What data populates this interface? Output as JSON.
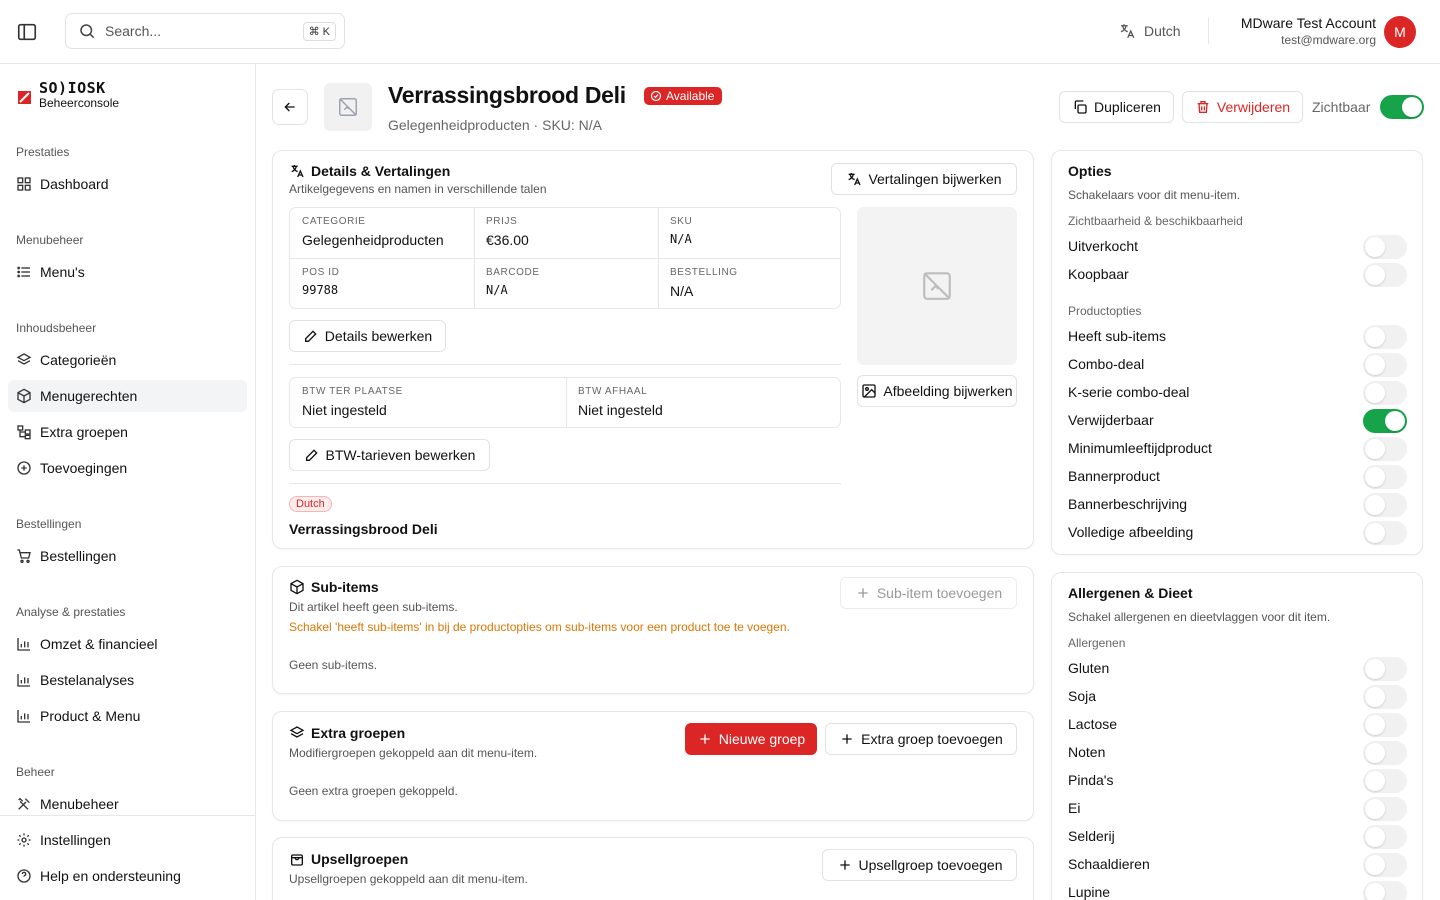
{
  "topbar": {
    "search_placeholder": "Search...",
    "search_shortcut": "⌘ K",
    "language": "Dutch",
    "account_name": "MDware Test Account",
    "account_email": "test@mdware.org",
    "avatar_initial": "M"
  },
  "brand": {
    "logo": "SO)IOSK",
    "subtitle": "Beheerconsole"
  },
  "sidebar": {
    "sections": [
      "Prestaties",
      "Menubeheer",
      "Inhoudsbeheer",
      "Bestellingen",
      "Analyse & prestaties",
      "Beheer"
    ],
    "items": {
      "dashboard": "Dashboard",
      "menus": "Menu's",
      "categories": "Categorieën",
      "dishes": "Menugerechten",
      "extra_groups": "Extra groepen",
      "additions": "Toevoegingen",
      "orders": "Bestellingen",
      "revenue": "Omzet & financieel",
      "order_analytics": "Bestelanalyses",
      "product_menu": "Product & Menu",
      "menu_management": "Menubeheer",
      "settings": "Instellingen",
      "help": "Help en ondersteuning"
    },
    "active": "Menugerechten"
  },
  "header": {
    "title": "Verrassingsbrood Deli",
    "status": "Available",
    "subtitle": "Gelegenheidproducten · SKU: N/A",
    "duplicate": "Dupliceren",
    "delete": "Verwijderen",
    "visible_label": "Zichtbaar",
    "visible": true
  },
  "details": {
    "title": "Details & Vertalingen",
    "description": "Artikelgegevens en namen in verschillende talen",
    "update_translations": "Vertalingen bijwerken",
    "fields": {
      "category": {
        "label": "Categorie",
        "value": "Gelegenheidproducten"
      },
      "price": {
        "label": "Prijs",
        "value": "€36.00"
      },
      "sku": {
        "label": "SKU",
        "value": "N/A"
      },
      "pos_id": {
        "label": "POS ID",
        "value": "99788"
      },
      "barcode": {
        "label": "Barcode",
        "value": "N/A"
      },
      "order": {
        "label": "Bestelling",
        "value": "N/A"
      }
    },
    "edit_details": "Details bewerken",
    "vat": {
      "dine_in": {
        "label": "BTW ter plaatse",
        "value": "Niet ingesteld"
      },
      "takeaway": {
        "label": "BTW afhaal",
        "value": "Niet ingesteld"
      }
    },
    "edit_vat": "BTW-tarieven bewerken",
    "update_image": "Afbeelding bijwerken",
    "translation_lang": "Dutch",
    "translation_name": "Verrassingsbrood Deli"
  },
  "subitems": {
    "title": "Sub-items",
    "description": "Dit artikel heeft geen sub-items.",
    "warning": "Schakel 'heeft sub-items' in bij de productopties om sub-items voor een product toe te voegen.",
    "add": "Sub-item toevoegen",
    "empty": "Geen sub-items."
  },
  "extra_groups": {
    "title": "Extra groepen",
    "description": "Modifiergroepen gekoppeld aan dit menu-item.",
    "new": "Nieuwe groep",
    "add": "Extra groep toevoegen",
    "empty": "Geen extra groepen gekoppeld."
  },
  "upsell": {
    "title": "Upsellgroepen",
    "description": "Upsellgroepen gekoppeld aan dit menu-item.",
    "add": "Upsellgroep toevoegen"
  },
  "options": {
    "title": "Opties",
    "description": "Schakelaars voor dit menu-item.",
    "group_visibility": "Zichtbaarheid & beschikbaarheid",
    "group_product": "Productopties",
    "visibility": [
      {
        "label": "Uitverkocht",
        "on": false
      },
      {
        "label": "Koopbaar",
        "on": false
      }
    ],
    "product": [
      {
        "label": "Heeft sub-items",
        "on": false
      },
      {
        "label": "Combo-deal",
        "on": false
      },
      {
        "label": "K-serie combo-deal",
        "on": false
      },
      {
        "label": "Verwijderbaar",
        "on": true
      },
      {
        "label": "Minimumleeftijdproduct",
        "on": false
      },
      {
        "label": "Bannerproduct",
        "on": false
      },
      {
        "label": "Bannerbeschrijving",
        "on": false
      },
      {
        "label": "Volledige afbeelding",
        "on": false
      }
    ]
  },
  "allergens": {
    "title": "Allergenen & Dieet",
    "description": "Schakel allergenen en dieetvlaggen voor dit item.",
    "group": "Allergenen",
    "items": [
      {
        "label": "Gluten",
        "on": false
      },
      {
        "label": "Soja",
        "on": false
      },
      {
        "label": "Lactose",
        "on": false
      },
      {
        "label": "Noten",
        "on": false
      },
      {
        "label": "Pinda's",
        "on": false
      },
      {
        "label": "Ei",
        "on": false
      },
      {
        "label": "Selderij",
        "on": false
      },
      {
        "label": "Schaaldieren",
        "on": false
      },
      {
        "label": "Lupine",
        "on": false
      }
    ]
  },
  "colors": {
    "accent": "#dc2626",
    "toggle_on": "#16a34a"
  }
}
